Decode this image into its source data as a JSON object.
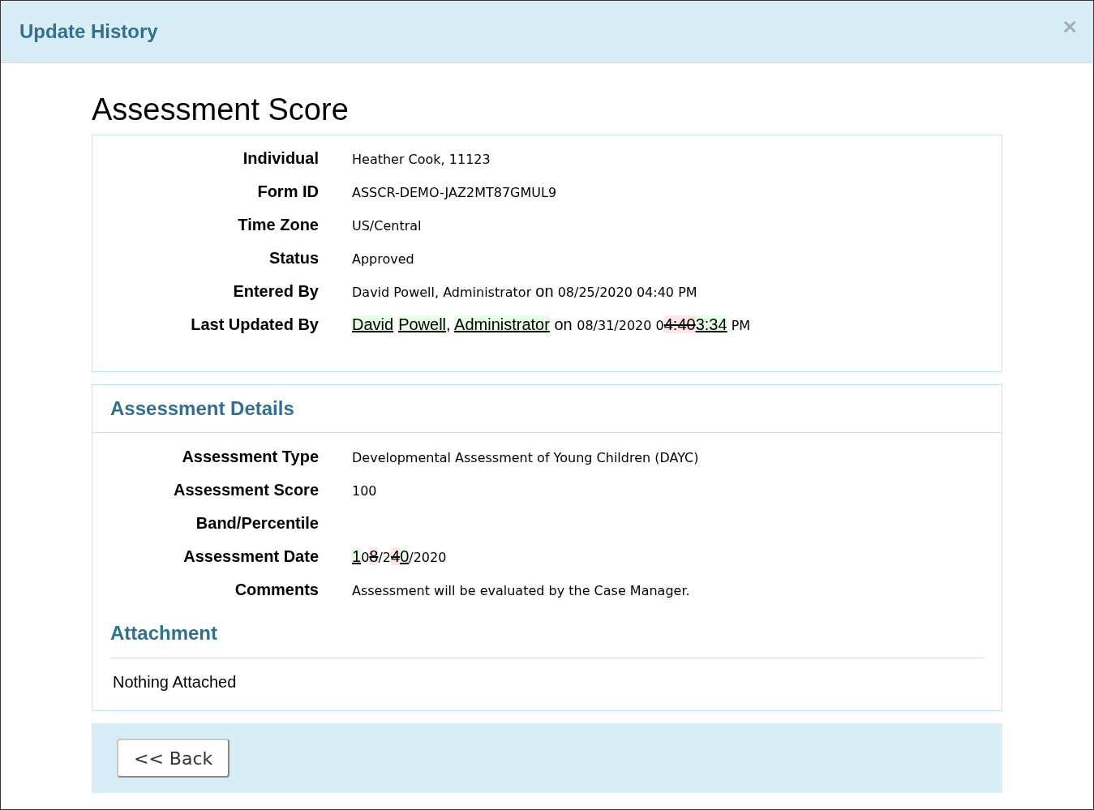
{
  "dialog": {
    "title": "Update History",
    "close": "×"
  },
  "heading": "Assessment Score",
  "summary": [
    {
      "label": "Individual",
      "value": [
        {
          "kind": "text",
          "text": "Heather Cook, 11123"
        }
      ]
    },
    {
      "label": "Form ID",
      "value": [
        {
          "kind": "text",
          "text": "ASSCR-DEMO-JAZ2MT87GMUL9"
        }
      ]
    },
    {
      "label": "Time Zone",
      "value": [
        {
          "kind": "text",
          "text": "US/Central"
        }
      ]
    },
    {
      "label": "Status",
      "value": [
        {
          "kind": "text",
          "text": "Approved"
        }
      ]
    },
    {
      "label": "Entered By",
      "value": [
        {
          "kind": "text",
          "text": "David Powell, Administrator "
        },
        {
          "kind": "sans",
          "text": "on"
        },
        {
          "kind": "text",
          "text": " 08/25/2020 04:40 PM"
        }
      ]
    },
    {
      "label": "Last Updated By",
      "value": [
        {
          "kind": "added",
          "text": "David"
        },
        {
          "kind": "added",
          "text": "Powell"
        },
        {
          "kind": "sans",
          "text": ", "
        },
        {
          "kind": "added",
          "text": "Administrator"
        },
        {
          "kind": "sans",
          "text": " on "
        },
        {
          "kind": "text",
          "text": "08/31/2020 0"
        },
        {
          "kind": "removed",
          "text": "4:40"
        },
        {
          "kind": "added",
          "text": "3:34"
        },
        {
          "kind": "text",
          "text": " PM"
        }
      ]
    }
  ],
  "details": {
    "title": "Assessment Details",
    "rows": [
      {
        "label": "Assessment Type",
        "value": [
          {
            "kind": "text",
            "text": "Developmental Assessment of Young Children (DAYC)"
          }
        ]
      },
      {
        "label": "Assessment Score",
        "value": [
          {
            "kind": "text",
            "text": "100"
          }
        ]
      },
      {
        "label": "Band/Percentile",
        "value": []
      },
      {
        "label": "Assessment Date",
        "value": [
          {
            "kind": "added",
            "text": "1"
          },
          {
            "kind": "text",
            "text": "0"
          },
          {
            "kind": "removed",
            "text": "8"
          },
          {
            "kind": "text",
            "text": "/2"
          },
          {
            "kind": "removed",
            "text": "4"
          },
          {
            "kind": "added",
            "text": "0"
          },
          {
            "kind": "text",
            "text": "/2020"
          }
        ]
      },
      {
        "label": "Comments",
        "value": [
          {
            "kind": "text",
            "text": "Assessment will be evaluated by the Case Manager."
          }
        ]
      }
    ],
    "attachment": {
      "title": "Attachment",
      "text": "Nothing Attached"
    }
  },
  "back_button": "<< Back"
}
